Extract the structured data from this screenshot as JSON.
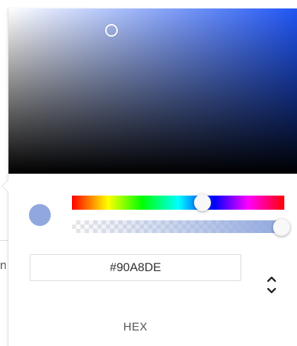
{
  "underlay": {
    "partial_text": "n"
  },
  "color_picker": {
    "current_color": "#90A8DE",
    "hue_color": "#1f55f5",
    "hue_value": 0.61,
    "alpha_value": 1.0,
    "hex_input": {
      "value": "#90A8DE"
    },
    "mode_label": "HEX",
    "toggle_icon": "chevron-up-down-icon"
  }
}
